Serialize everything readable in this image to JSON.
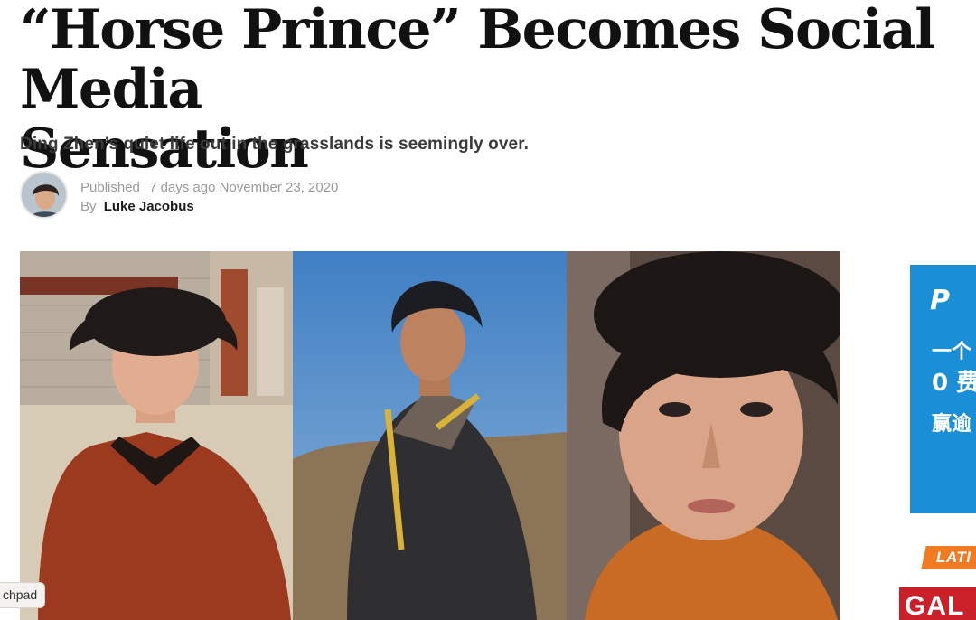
{
  "article": {
    "headline": "“Horse Prince” Becomes Social Media\nSensation",
    "subheadline": "Ding Zhen’s quiet life out in the grasslands is seemingly over.",
    "published_label": "Published",
    "published_ago": "7 days ago",
    "published_date": "November 23, 2020",
    "by_label": "By",
    "author": "Luke Jacobus"
  },
  "ad": {
    "logo_text": "P",
    "line1": "一个",
    "line2": "0 费",
    "line3": "赢逾"
  },
  "sidebar": {
    "latest_label": "LATI",
    "latest_thumb_text": "GAL"
  },
  "tooltip": {
    "text": "chpad"
  },
  "colors": {
    "ad_blue": "#1a8fd6",
    "latest_orange": "#f07b22",
    "thumb_red": "#c9202a"
  }
}
